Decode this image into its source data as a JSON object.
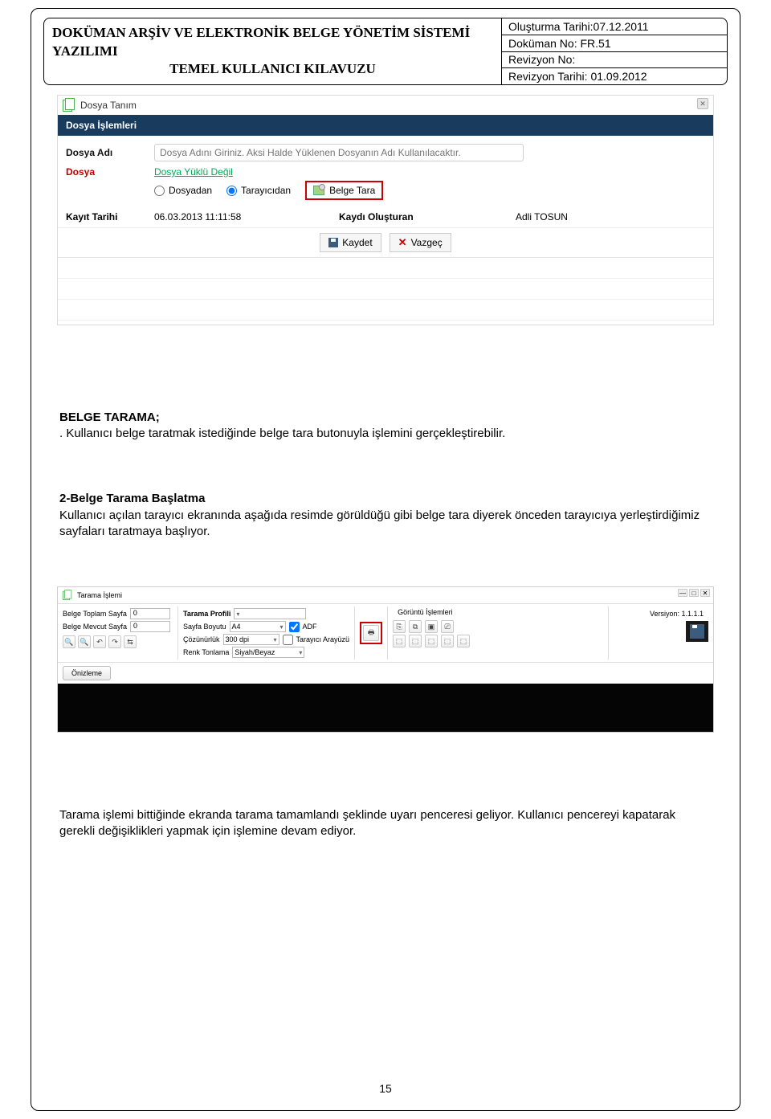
{
  "header": {
    "title_l1": "DOKÜMAN ARŞİV VE ELEKTRONİK BELGE YÖNETİM SİSTEMİ YAZILIMI",
    "title_l2": "TEMEL KULLANICI KILAVUZU",
    "m1": "Oluşturma Tarihi:07.12.2011",
    "m2": "Doküman No: FR.51",
    "m3": "Revizyon No:",
    "m4": "Revizyon Tarihi: 01.09.2012"
  },
  "dialog1": {
    "title": "Dosya Tanım",
    "section": "Dosya İşlemleri",
    "file_name_lbl": "Dosya Adı",
    "file_name_placeholder": "Dosya Adını Giriniz. Aksi Halde Yüklenen Dosyanın Adı Kullanılacaktır.",
    "file_lbl": "Dosya",
    "no_file_link": "Dosya  Yüklü  Değil",
    "opt_from_file": "Dosyadan",
    "opt_from_scanner": "Tarayıcıdan",
    "btn_belge_tara": "Belge Tara",
    "created_lbl": "Kayıt Tarihi",
    "created_val": "06.03.2013 11:11:58",
    "creator_lbl": "Kaydı Oluşturan",
    "creator_val": "Adli TOSUN",
    "btn_save": "Kaydet",
    "btn_cancel": "Vazgeç"
  },
  "body": {
    "h1": "BELGE TARAMA;",
    "p1": ". Kullanıcı belge taratmak istediğinde belge tara butonuyla işlemini gerçekleştirebilir.",
    "h2": "2-Belge Tarama Başlatma",
    "p2": "Kullanıcı açılan tarayıcı ekranında aşağıda resimde görüldüğü gibi belge tara diyerek önceden tarayıcıya yerleştirdiğimiz sayfaları taratmaya başlıyor.",
    "p3": "Tarama işlemi bittiğinde ekranda tarama tamamlandı şeklinde uyarı penceresi geliyor. Kullanıcı pencereyi kapatarak gerekli değişiklikleri yapmak için işlemine devam ediyor."
  },
  "dialog2": {
    "title": "Tarama İşlemi",
    "lbl_total": "Belge Toplam Sayfa",
    "val_total": "0",
    "lbl_current": "Belge Mevcut Sayfa",
    "val_current": "0",
    "group_profile": "Tarama Profili",
    "lbl_pagesize": "Sayfa Boyutu",
    "val_pagesize": "A4",
    "chk_adf": "ADF",
    "lbl_res": "Çözünürlük",
    "val_res": "300 dpi",
    "chk_ui": "Tarayıcı Arayüzü",
    "lbl_color": "Renk Tonlama",
    "val_color": "Siyah/Beyaz",
    "group_image": "Görüntü İşlemleri",
    "preview_btn": "Önizleme",
    "version": "Versiyon: 1.1.1.1"
  },
  "page_number": "15"
}
